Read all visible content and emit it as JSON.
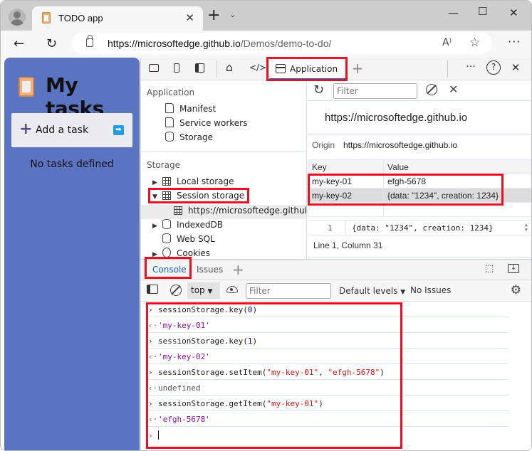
{
  "browser": {
    "tab_title": "TODO app",
    "url_host": "https://microsoftedge.github.io",
    "url_path": "/Demos/demo-to-do/",
    "icons": [
      "profile-icon",
      "favicon-clipboard",
      "close-icon",
      "new-tab-icon",
      "tab-dropdown-icon",
      "minimize-icon",
      "maximize-icon",
      "window-close-icon",
      "back-icon",
      "refresh-icon",
      "lock-icon",
      "read-aloud-icon",
      "favorite-star-icon",
      "more-icon"
    ]
  },
  "app": {
    "title": "My tasks",
    "add_task_label": "Add a task",
    "empty_message": "No tasks defined",
    "background": "#5b74c0"
  },
  "devtools": {
    "toolbar": {
      "active_tab": "Application",
      "icons": [
        "inspect-icon",
        "device-emulation-icon",
        "dock-icon",
        "welcome-home-icon",
        "elements-icon",
        "add-tab-icon",
        "more-icon",
        "help-icon",
        "close-icon"
      ]
    },
    "sidebar": {
      "application_header": "Application",
      "application_items": [
        "Manifest",
        "Service workers",
        "Storage"
      ],
      "storage_header": "Storage",
      "storage_items": [
        {
          "label": "Local storage",
          "expanded": false
        },
        {
          "label": "Session storage",
          "expanded": true
        },
        {
          "label": "https://microsoftedge.github.io",
          "child": true,
          "selected": true
        },
        {
          "label": "IndexedDB",
          "expanded": false
        },
        {
          "label": "Web SQL"
        },
        {
          "label": "Cookies",
          "expanded": false
        }
      ]
    },
    "storage_view": {
      "filter_placeholder": "Filter",
      "origin_heading": "https://microsoftedge.github.io",
      "origin_label": "Origin",
      "origin_value": "https://microsoftedge.github.io",
      "columns": [
        "Key",
        "Value"
      ],
      "rows": [
        {
          "key": "my-key-01",
          "value": "efgh-5678"
        },
        {
          "key": "my-key-02",
          "value": "{data: \"1234\", creation: 1234}",
          "selected": true
        }
      ],
      "preview_line_number": "1",
      "preview_code": "{data: \"1234\", creation: 1234}",
      "status": "Line 1, Column 31"
    },
    "drawer": {
      "tabs": [
        "Console",
        "Issues"
      ],
      "active_tab": "Console",
      "context": "top",
      "filter_placeholder": "Filter",
      "levels": "Default levels",
      "issues": "No Issues"
    },
    "console": [
      {
        "type": "input",
        "parts": [
          {
            "t": "sessionStorage.key("
          },
          {
            "t": "0",
            "c": "num"
          },
          {
            "t": ")"
          }
        ]
      },
      {
        "type": "output",
        "parts": [
          {
            "t": "'my-key-01'",
            "c": "str"
          }
        ]
      },
      {
        "type": "input",
        "parts": [
          {
            "t": "sessionStorage.key("
          },
          {
            "t": "1",
            "c": "num"
          },
          {
            "t": ")"
          }
        ]
      },
      {
        "type": "output",
        "parts": [
          {
            "t": "'my-key-02'",
            "c": "str"
          }
        ]
      },
      {
        "type": "input",
        "parts": [
          {
            "t": "sessionStorage.setItem("
          },
          {
            "t": "\"my-key-01\"",
            "c": "dstr"
          },
          {
            "t": ", "
          },
          {
            "t": "\"efgh-5678\"",
            "c": "dstr"
          },
          {
            "t": ")"
          }
        ]
      },
      {
        "type": "output",
        "parts": [
          {
            "t": "undefined",
            "c": "undef"
          }
        ]
      },
      {
        "type": "input",
        "parts": [
          {
            "t": "sessionStorage.getItem("
          },
          {
            "t": "\"my-key-01\"",
            "c": "dstr"
          },
          {
            "t": ")"
          }
        ]
      },
      {
        "type": "output",
        "parts": [
          {
            "t": "'efgh-5678'",
            "c": "str"
          }
        ]
      }
    ],
    "highlight_color": "#e81123"
  }
}
